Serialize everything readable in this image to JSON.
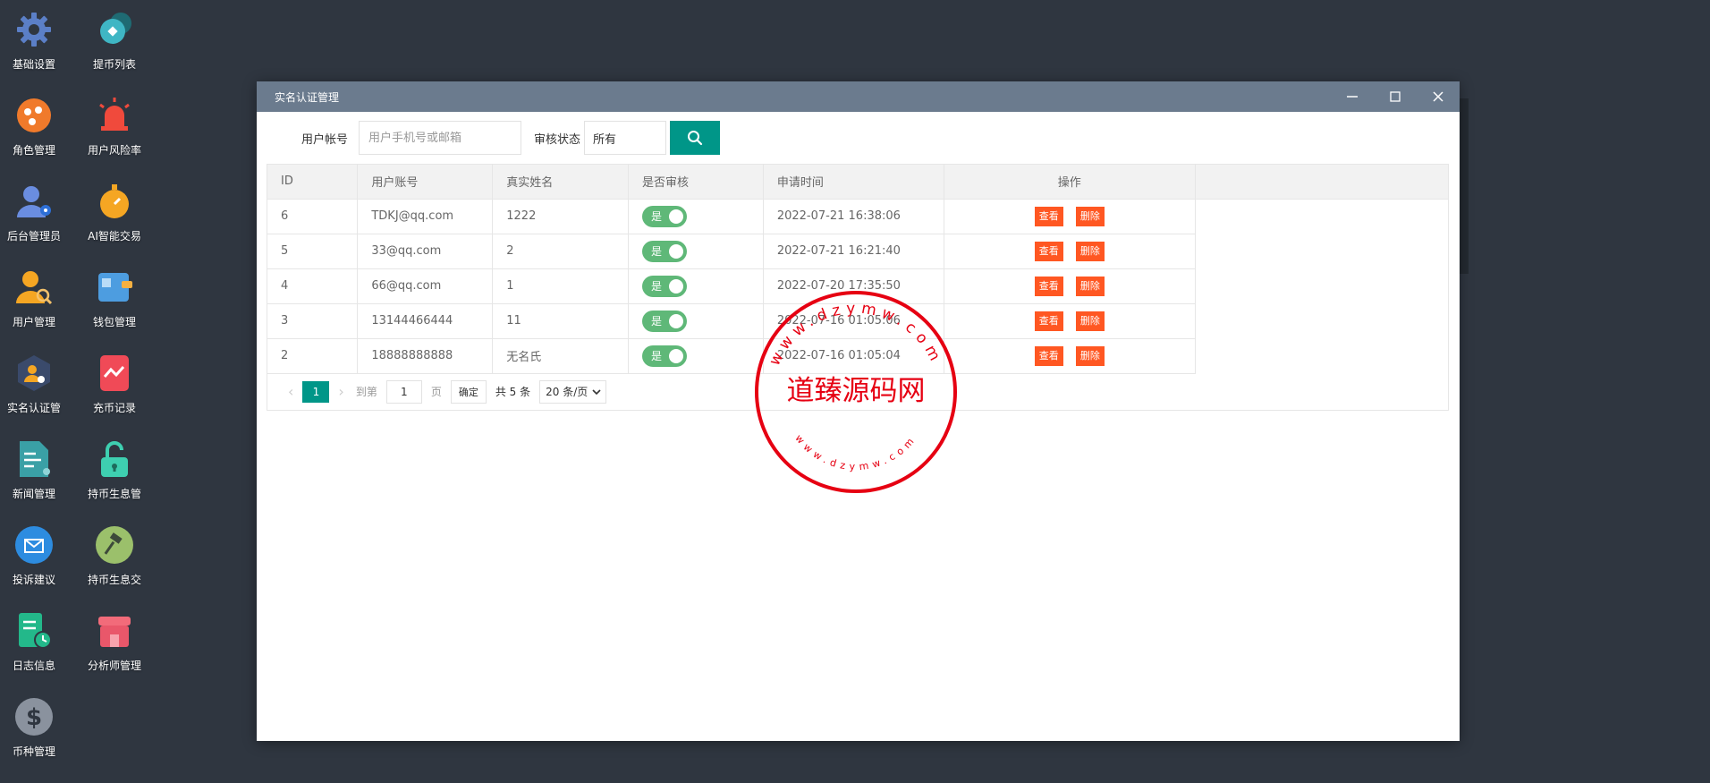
{
  "desktop": {
    "icons": [
      {
        "label": "基础设置",
        "icon": "gear-icon",
        "color": "#5b7fc7"
      },
      {
        "label": "提币列表",
        "icon": "coin-list-icon",
        "color": "#3fb6c4"
      },
      {
        "label": "角色管理",
        "icon": "role-icon",
        "color": "#f07a2b"
      },
      {
        "label": "用户风险率",
        "icon": "alarm-icon",
        "color": "#f04a3c"
      },
      {
        "label": "后台管理员",
        "icon": "admin-icon",
        "color": "#6a8de0"
      },
      {
        "label": "AI智能交易",
        "icon": "timer-icon",
        "color": "#f5a623"
      },
      {
        "label": "用户管理",
        "icon": "user-search-icon",
        "color": "#f5a623"
      },
      {
        "label": "钱包管理",
        "icon": "wallet-icon",
        "color": "#4d9de0"
      },
      {
        "label": "实名认证管",
        "icon": "verify-icon",
        "color": "#3a4a6b"
      },
      {
        "label": "充币记录",
        "icon": "chart-card-icon",
        "color": "#f04a57"
      },
      {
        "label": "新闻管理",
        "icon": "news-icon",
        "color": "#3aa0a6"
      },
      {
        "label": "持币生息管",
        "icon": "unlock-icon",
        "color": "#3ecfb0"
      },
      {
        "label": "投诉建议",
        "icon": "mail-icon",
        "color": "#2d8ce0"
      },
      {
        "label": "持币生息交",
        "icon": "hammer-icon",
        "color": "#9bc06b"
      },
      {
        "label": "日志信息",
        "icon": "log-icon",
        "color": "#23b88a"
      },
      {
        "label": "分析师管理",
        "icon": "shop-icon",
        "color": "#f26b7a"
      },
      {
        "label": "币种管理",
        "icon": "dollar-icon",
        "color": "#8a929e"
      }
    ]
  },
  "window": {
    "title": "实名认证管理"
  },
  "search": {
    "account_label": "用户帐号",
    "account_placeholder": "用户手机号或邮箱",
    "status_label": "审核状态",
    "status_value": "所有"
  },
  "table": {
    "headers": [
      "ID",
      "用户账号",
      "真实姓名",
      "是否审核",
      "申请时间",
      "操作"
    ],
    "rows": [
      {
        "id": "6",
        "account": "TDKJ@qq.com",
        "name": "1222",
        "audit": "是",
        "time": "2022-07-21 16:38:06"
      },
      {
        "id": "5",
        "account": "33@qq.com",
        "name": "2",
        "audit": "是",
        "time": "2022-07-21 16:21:40"
      },
      {
        "id": "4",
        "account": "66@qq.com",
        "name": "1",
        "audit": "是",
        "time": "2022-07-20 17:35:50"
      },
      {
        "id": "3",
        "account": "13144466444",
        "name": "11",
        "audit": "是",
        "time": "2022-07-16 01:05:06"
      },
      {
        "id": "2",
        "account": "18888888888",
        "name": "无名氏",
        "audit": "是",
        "time": "2022-07-16 01:05:04"
      }
    ],
    "view_label": "查看",
    "delete_label": "删除"
  },
  "pager": {
    "current": "1",
    "goto_label": "到第",
    "goto_value": "1",
    "page_suffix": "页",
    "confirm_label": "确定",
    "total_label": "共 5 条",
    "size_label": "20 条/页"
  },
  "watermark": {
    "center_text": "道臻源码网",
    "ring_text": "www.dzymw.com"
  },
  "colors": {
    "desktop_bg": "#2f3640",
    "titlebar": "#6b7b8e",
    "primary": "#009688",
    "danger": "#ff5722",
    "switch_on": "#5fb878",
    "stamp": "#e60012"
  }
}
